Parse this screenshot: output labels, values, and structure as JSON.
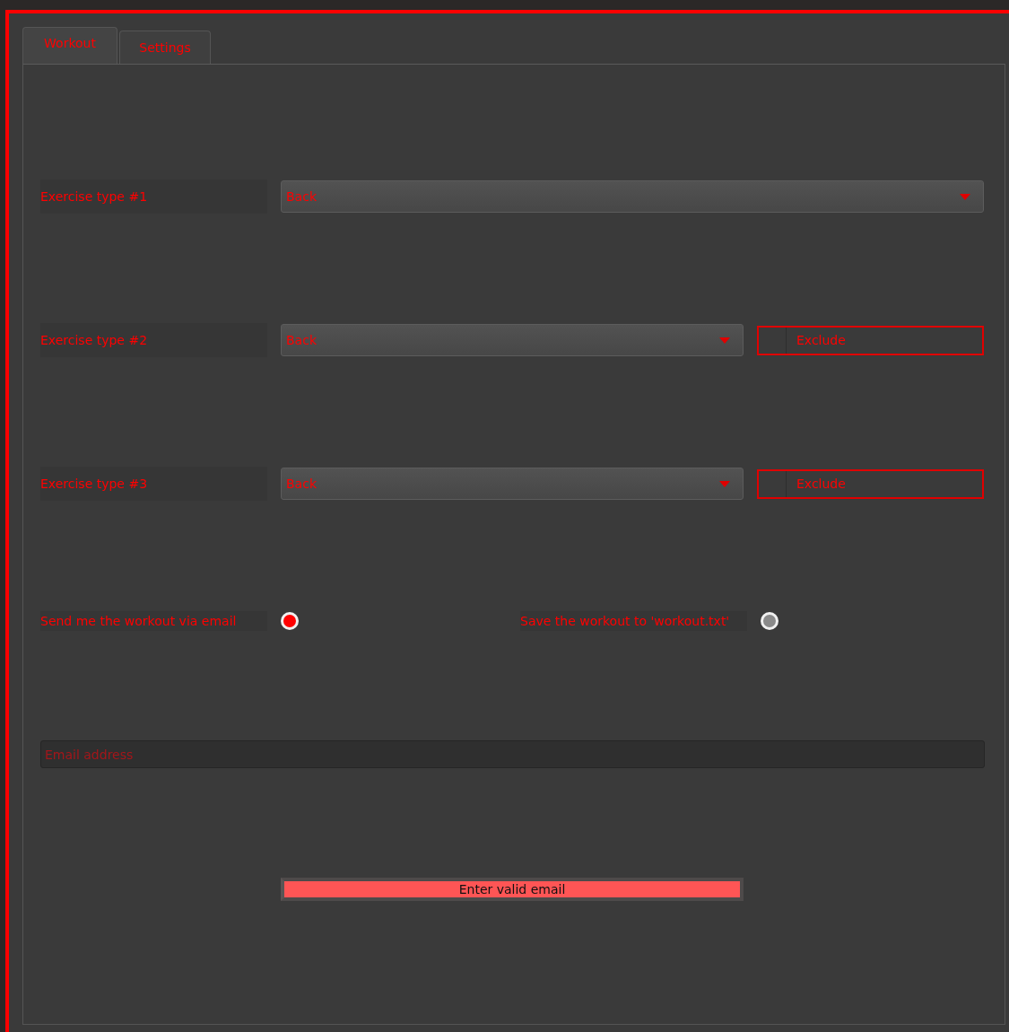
{
  "tabs": [
    {
      "label": "Workout",
      "selected": true
    },
    {
      "label": "Settings",
      "selected": false
    }
  ],
  "exercises": [
    {
      "label": "Exercise type #1",
      "value": "Back"
    },
    {
      "label": "Exercise type #2",
      "value": "Back",
      "exclude": {
        "label": "Exclude",
        "checked": false
      }
    },
    {
      "label": "Exercise type #3",
      "value": "Back",
      "exclude": {
        "label": "Exclude",
        "checked": false
      }
    }
  ],
  "output_options": [
    {
      "label": "Send me the workout via email",
      "selected": true
    },
    {
      "label": "Save the workout to 'workout.txt'",
      "selected": false
    }
  ],
  "email": {
    "placeholder": "Email address"
  },
  "status_button": {
    "label": "Enter valid email"
  }
}
